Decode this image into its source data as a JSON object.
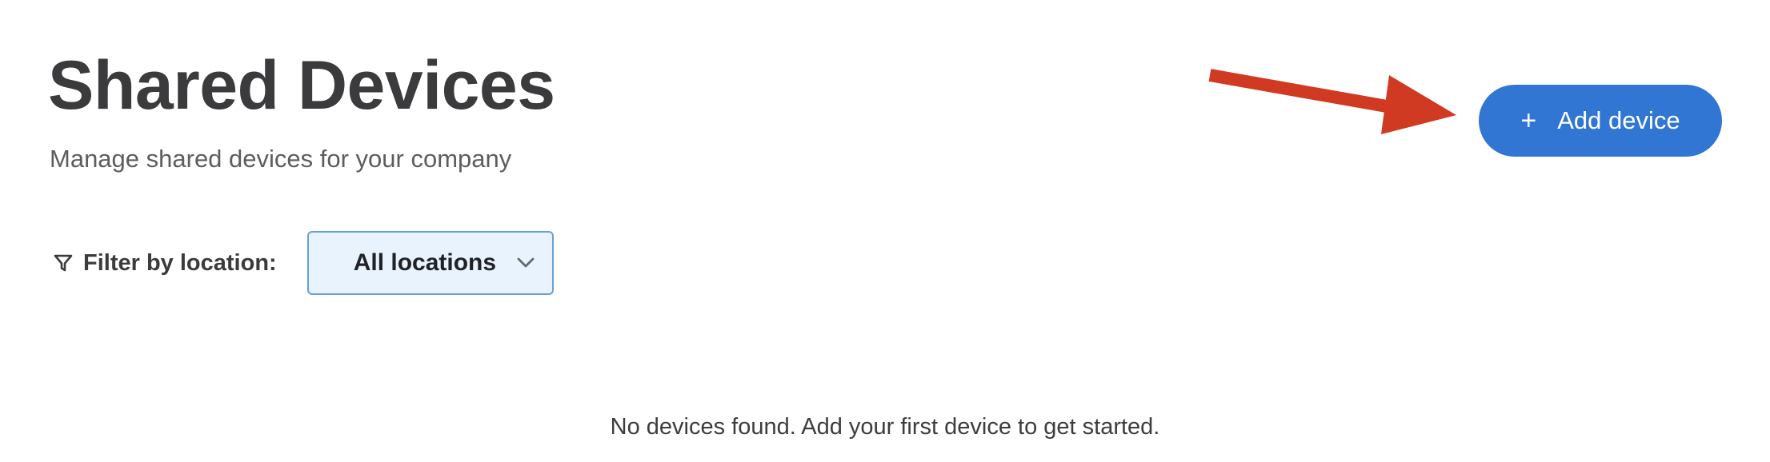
{
  "header": {
    "title": "Shared Devices",
    "subtitle": "Manage shared devices for your company"
  },
  "actions": {
    "add_device_label": "Add device",
    "add_device_icon": "plus-icon",
    "accent_color": "#3276d3"
  },
  "annotation": {
    "arrow_color": "#d13a22",
    "arrow_target": "add-device-button"
  },
  "filter": {
    "label": "Filter by location:",
    "icon": "funnel-icon",
    "selected_value": "All locations",
    "dropdown_icon": "chevron-down-icon"
  },
  "empty_state": {
    "message": "No devices found. Add your first device to get started."
  }
}
